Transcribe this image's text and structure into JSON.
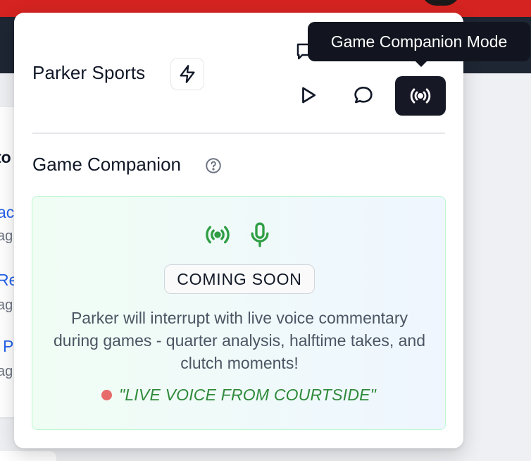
{
  "background": {
    "partial_title": "to",
    "links": [
      {
        "text": "ac",
        "sub": "ag"
      },
      {
        "text": "Re",
        "sub": "ag"
      },
      {
        "text": "P",
        "sub": "ag"
      }
    ]
  },
  "header": {
    "brand": "Parker Sports",
    "icons": [
      "lightning-icon",
      "play-icon",
      "chat-icon",
      "broadcast-icon"
    ]
  },
  "tooltip": {
    "text": "Game Companion Mode"
  },
  "section": {
    "title": "Game Companion",
    "help_icon": "question-circle-icon"
  },
  "companion": {
    "icons": [
      "broadcast-icon",
      "microphone-icon"
    ],
    "badge": "COMING SOON",
    "description": "Parker will interrupt with live voice commentary during games - quarter analysis, halftime takes, and clutch moments!",
    "live_text": "\"LIVE VOICE FROM COURTSIDE\""
  },
  "colors": {
    "active_button": "#161925",
    "accent_green": "#2f9e44",
    "live_dot": "#e86b6b",
    "top_bar": "#d42320"
  }
}
